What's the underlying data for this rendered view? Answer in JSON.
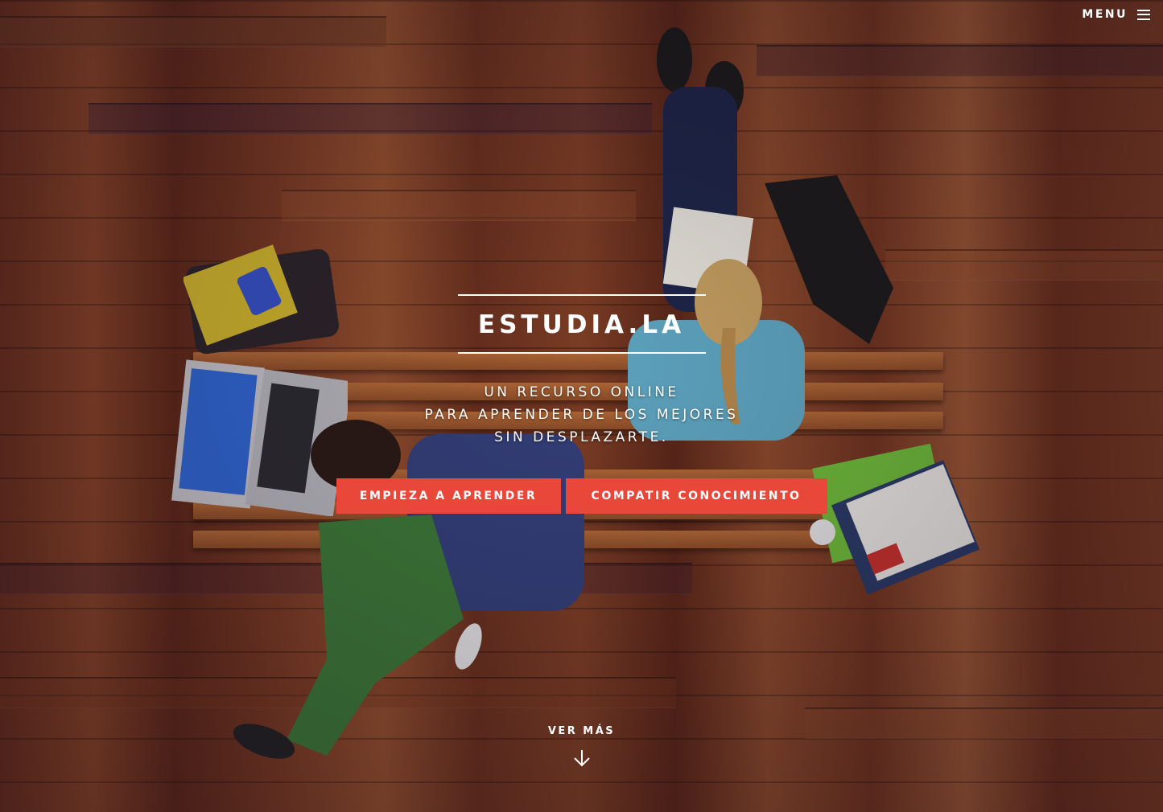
{
  "header": {
    "menu_label": "MENU",
    "menu_icon": "hamburger-icon"
  },
  "hero": {
    "title": "ESTUDIA.LA",
    "subtitle_lines": [
      "UN RECURSO ONLINE",
      "PARA APRENDER DE LOS MEJORES",
      "SIN DESPLAZARTE."
    ],
    "buttons": {
      "learn": "EMPIEZA A APRENDER",
      "share": "COMPATIR CONOCIMIENTO"
    }
  },
  "footer": {
    "more_label": "VER MÁS",
    "more_icon": "arrow-down-icon"
  },
  "colors": {
    "accent": "#e8473a",
    "text": "#ffffff"
  }
}
